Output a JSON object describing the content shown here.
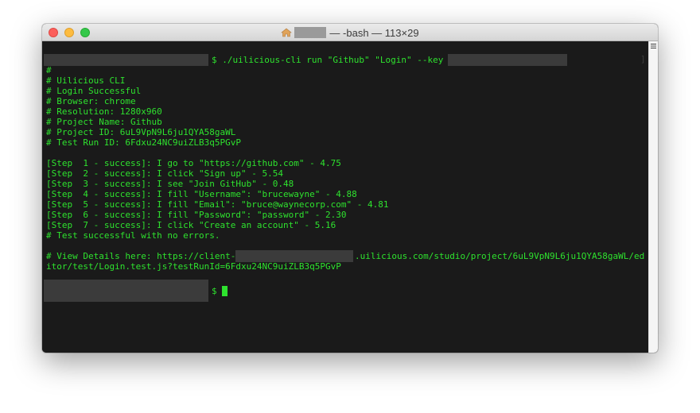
{
  "window": {
    "title_suffix": "— -bash — 113×29"
  },
  "terminal": {
    "lines": [
      "$ ./uilicious-cli run \"Github\" \"Login\" --key",
      "#",
      "# Uilicious CLI",
      "# Login Successful",
      "# Browser: chrome",
      "# Resolution: 1280x960",
      "# Project Name: Github",
      "# Project ID: 6uL9VpN9L6ju1QYA58gaWL",
      "# Test Run ID: 6Fdxu24NC9uiZLB3q5PGvP",
      "",
      "[Step  1 - success]: I go to \"https://github.com\" - 4.75",
      "[Step  2 - success]: I click \"Sign up\" - 5.54",
      "[Step  3 - success]: I see \"Join GitHub\" - 0.48",
      "[Step  4 - success]: I fill \"Username\": \"brucewayne\" - 4.88",
      "[Step  5 - success]: I fill \"Email\": \"bruce@waynecorp.com\" - 4.81",
      "[Step  6 - success]: I fill \"Password\": \"password\" - 2.30",
      "[Step  7 - success]: I click \"Create an account\" - 5.16",
      "# Test successful with no errors.",
      "",
      "# View Details here: https://client-",
      ".uilicious.com/studio/project/6uL9VpN9L6ju1QYA58gaWL/ed",
      "itor/test/Login.test.js?testRunId=6Fdxu24NC9uiZLB3q5PGvP",
      "",
      "$"
    ],
    "bracket": "]"
  },
  "colors": {
    "terminal_bg": "#1a1a1a",
    "terminal_fg": "#2ee22e",
    "redaction": "#3b3b3b"
  },
  "icons": {
    "title": "home-icon",
    "scroll": "scroll-indicator-icon"
  }
}
